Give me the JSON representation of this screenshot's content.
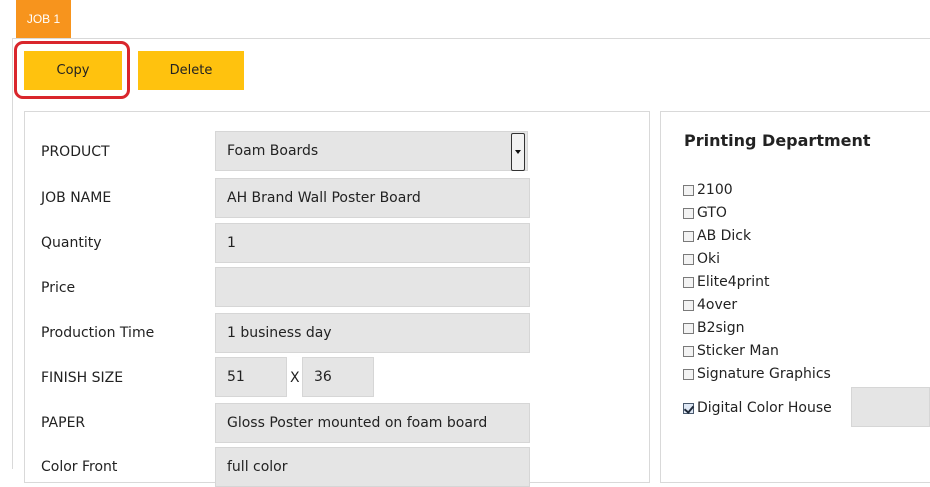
{
  "tab": {
    "label": "JOB 1"
  },
  "actions": {
    "copy_label": "Copy",
    "delete_label": "Delete"
  },
  "form": {
    "product_label": "PRODUCT",
    "product_value": "Foam Boards",
    "job_name_label": "JOB NAME",
    "job_name_value": "AH Brand Wall Poster Board",
    "quantity_label": "Quantity",
    "quantity_value": "1",
    "price_label": "Price",
    "price_value": "",
    "production_time_label": "Production Time",
    "production_time_value": "1 business day",
    "finish_size_label": "FINISH SIZE",
    "finish_width": "51",
    "finish_separator": "X",
    "finish_height": "36",
    "paper_label": "PAPER",
    "paper_value": "Gloss Poster mounted on foam board",
    "color_front_label": "Color Front",
    "color_front_value": "full color"
  },
  "printing": {
    "title": "Printing Department",
    "options": [
      {
        "label": "2100",
        "checked": false
      },
      {
        "label": "GTO",
        "checked": false
      },
      {
        "label": "AB Dick",
        "checked": false
      },
      {
        "label": "Oki",
        "checked": false
      },
      {
        "label": "Elite4print",
        "checked": false
      },
      {
        "label": "4over",
        "checked": false
      },
      {
        "label": "B2sign",
        "checked": false
      },
      {
        "label": "Sticker Man",
        "checked": false
      },
      {
        "label": "Signature Graphics",
        "checked": false
      },
      {
        "label": "Digital Color House",
        "checked": true
      }
    ]
  },
  "colors": {
    "tab_orange": "#f7941d",
    "button_yellow": "#ffc20e",
    "highlight_red": "#d9262c"
  }
}
